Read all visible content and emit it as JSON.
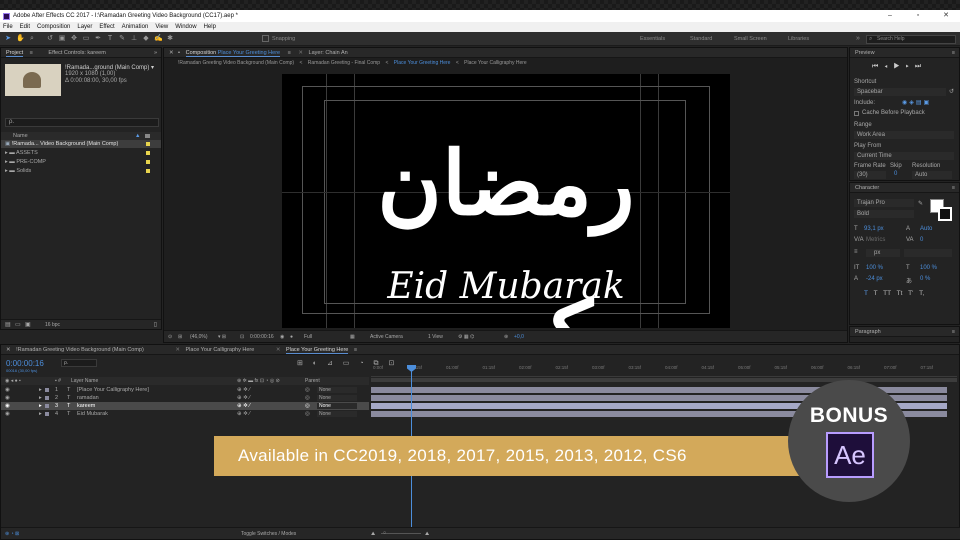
{
  "window": {
    "title": "Adobe After Effects CC 2017 - I:\\Ramadan Greeting Video Background (CC17).aep *"
  },
  "menu": [
    "File",
    "Edit",
    "Composition",
    "Layer",
    "Effect",
    "Animation",
    "View",
    "Window",
    "Help"
  ],
  "toolbar": {
    "snapping_label": "Snapping",
    "workspaces": [
      "Essentials",
      "Standard",
      "Small Screen",
      "Libraries"
    ],
    "search_placeholder": "Search Help"
  },
  "project": {
    "tab_project": "Project",
    "tab_effect_controls": "Effect Controls: kareem",
    "thumb_name": "!Ramada...ground (Main Comp) ▾",
    "thumb_res": "1920 x 1080 (1,00)",
    "thumb_dur": "Δ 0:00:08:00, 30,00 fps",
    "search_placeholder": "ρ.",
    "col_name": "Name",
    "items": [
      {
        "name": "!Ramada... Video Background (Main Comp)",
        "color": "#e8d44d"
      },
      {
        "name": "ASSETS",
        "color": "#e8d44d"
      },
      {
        "name": "PRE-COMP",
        "color": "#e8d44d"
      },
      {
        "name": "Solids",
        "color": "#e8d44d"
      }
    ],
    "bpc": "16 bpc"
  },
  "viewer": {
    "tab_composition": "Composition",
    "tab_composition_name": "Place Your Greeting Here",
    "tab_layer": "Layer: Chain An",
    "breadcrumbs": [
      "!Ramadan Greeting Video Background (Main Comp)",
      "Ramadan Greeting - Final Comp",
      "Place Your Greeting Here",
      "Place Your Calligraphy Here"
    ],
    "arabic_text": "رمضان كريم",
    "greeting_text": "Eid Mubarak",
    "zoom": "(46,0%)",
    "timecode": "0:00:00:16",
    "quality": "Full",
    "camera": "Active Camera",
    "views": "1 View",
    "exposure": "+0,0"
  },
  "preview": {
    "title": "Preview",
    "shortcut_label": "Shortcut",
    "shortcut_value": "Spacebar",
    "include_label": "Include:",
    "cache_label": "Cache Before Playback",
    "range_label": "Range",
    "range_value": "Work Area",
    "play_from_label": "Play From",
    "play_from_value": "Current Time",
    "frame_rate_label": "Frame Rate",
    "skip_label": "Skip",
    "resolution_label": "Resolution",
    "frame_rate_value": "(30)",
    "skip_value": "0",
    "resolution_value": "Auto"
  },
  "character": {
    "title": "Character",
    "font": "Trajan Pro",
    "style": "Bold",
    "size": "93,1 px",
    "leading": "Auto",
    "kerning": "Metrics",
    "tracking": "0",
    "stroke_unit": "px",
    "vscale": "100 %",
    "hscale": "100 %",
    "baseline": "-24 px",
    "tsume": "0 %",
    "styles": [
      "T",
      "T",
      "TT",
      "Tt",
      "T'",
      "T,"
    ]
  },
  "paragraph": {
    "title": "Paragraph"
  },
  "timeline": {
    "tabs": [
      "!Ramadan Greeting Video Background (Main Comp)",
      "Place Your Calligraphy Here",
      "Place Your Greeting Here"
    ],
    "timecode": "0:00:00:16",
    "fps_sub": "00016 (30,00 fps)",
    "col_layer_name": "Layer Name",
    "col_parent": "Parent",
    "layers": [
      {
        "num": "1",
        "name": "[Place Your Calligraphy Here]",
        "parent": "None",
        "color": "#8a8a9e"
      },
      {
        "num": "2",
        "name": "ramadan",
        "parent": "None",
        "color": "#8a8a9e"
      },
      {
        "num": "3",
        "name": "kareem",
        "parent": "None",
        "color": "#8a8a9e"
      },
      {
        "num": "4",
        "name": "Eid Mubarak",
        "parent": "None",
        "color": "#8a8a9e"
      }
    ],
    "ruler": [
      "0:00f",
      "00:15f",
      "01:00f",
      "01:15f",
      "02:00f",
      "02:15f",
      "03:00f",
      "03:15f",
      "04:00f",
      "04:15f",
      "05:00f",
      "05:15f",
      "06:00f",
      "06:15f",
      "07:00f",
      "07:15f"
    ],
    "toggle_label": "Toggle Switches / Modes"
  },
  "promo": {
    "banner_text": "Available in CC2019, 2018, 2017, 2015, 2013, 2012, CS6",
    "bonus_label": "BONUS",
    "ae_label": "Ae"
  }
}
